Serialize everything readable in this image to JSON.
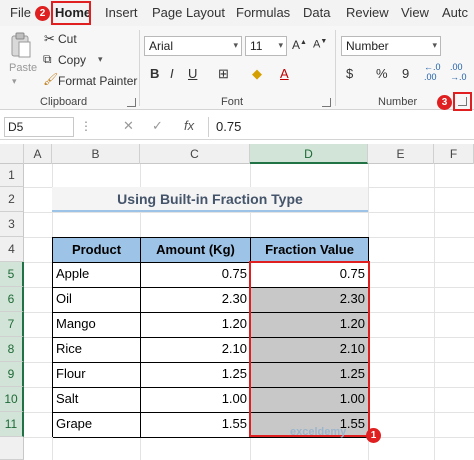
{
  "menu": {
    "items": [
      "File",
      "Home",
      "Insert",
      "Page Layout",
      "Formulas",
      "Data",
      "Review",
      "View",
      "Autc"
    ],
    "active": "Home"
  },
  "callouts": {
    "one": "1",
    "two": "2",
    "three": "3"
  },
  "clipboard": {
    "paste_label": "Paste",
    "cut_label": "Cut",
    "copy_label": "Copy",
    "format_painter_label": "Format Painter",
    "group_label": "Clipboard"
  },
  "font": {
    "name": "Arial",
    "size": "11",
    "group_label": "Font"
  },
  "number": {
    "format": "Number",
    "group_label": "Number",
    "icons": [
      "$",
      "%",
      "9"
    ]
  },
  "formula_bar": {
    "name_box": "D5",
    "fx": "fx",
    "value": "0.75"
  },
  "columns": [
    "A",
    "B",
    "C",
    "D",
    "E",
    "F"
  ],
  "rows": [
    "1",
    "2",
    "3",
    "4",
    "5",
    "6",
    "7",
    "8",
    "9",
    "10",
    "11"
  ],
  "sheet": {
    "title": "Using Built-in Fraction Type",
    "headers": [
      "Product",
      "Amount (Kg)",
      "Fraction Value"
    ],
    "data": [
      [
        "Apple",
        "0.75",
        "0.75"
      ],
      [
        "Oil",
        "2.30",
        "2.30"
      ],
      [
        "Mango",
        "1.20",
        "1.20"
      ],
      [
        "Rice",
        "2.10",
        "2.10"
      ],
      [
        "Flour",
        "1.25",
        "1.25"
      ],
      [
        "Salt",
        "1.00",
        "1.00"
      ],
      [
        "Grape",
        "1.55",
        "1.55"
      ]
    ]
  },
  "watermark": "exceldemy",
  "colors": {
    "header_fill": "#9dc3e6",
    "selection_fill": "#c8c8c8",
    "highlight_red": "#e02020",
    "excel_green": "#217346"
  }
}
